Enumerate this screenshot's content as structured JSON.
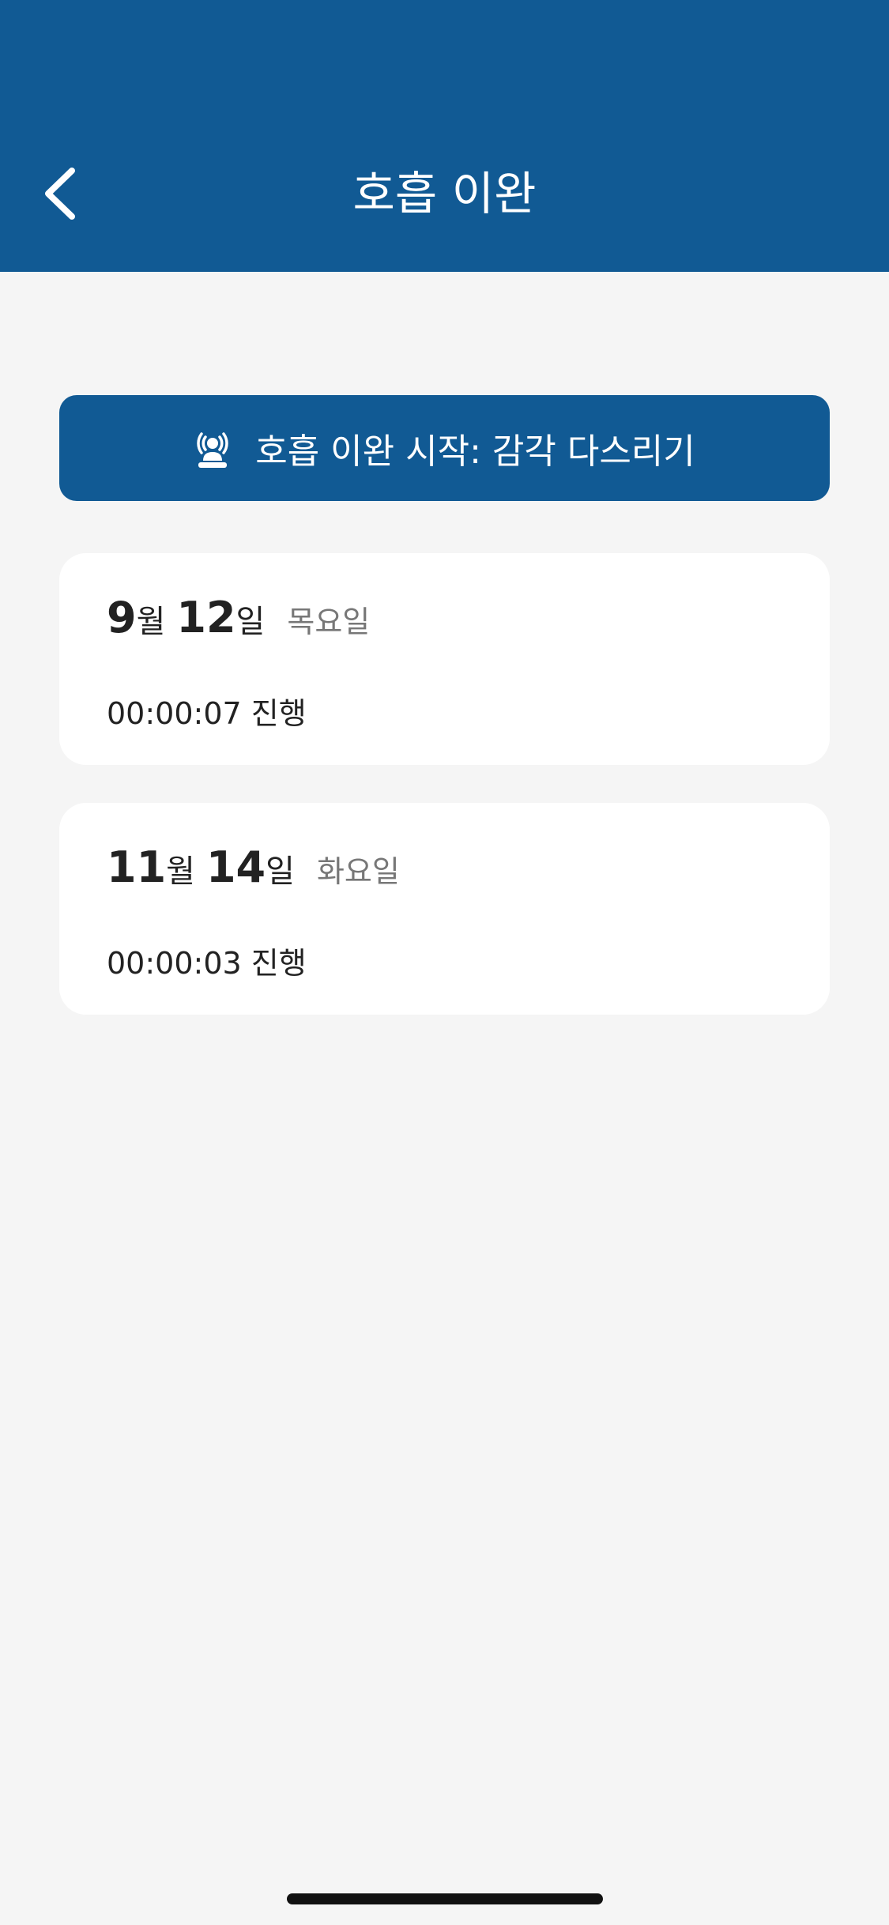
{
  "header": {
    "title": "호흡 이완",
    "back_icon": "chevron-left-icon"
  },
  "start_button": {
    "label": "호흡 이완 시작: 감각 다스리기",
    "icon": "meditation-person-icon"
  },
  "sessions": [
    {
      "month": "9",
      "month_unit": "월",
      "day": "12",
      "day_unit": "일",
      "weekday": "목요일",
      "duration": "00:00:07 진행"
    },
    {
      "month": "11",
      "month_unit": "월",
      "day": "14",
      "day_unit": "일",
      "weekday": "화요일",
      "duration": "00:00:03 진행"
    }
  ],
  "colors": {
    "brand": "#115a94",
    "background": "#f5f5f5",
    "card": "#ffffff",
    "secondary_text": "#777777"
  }
}
